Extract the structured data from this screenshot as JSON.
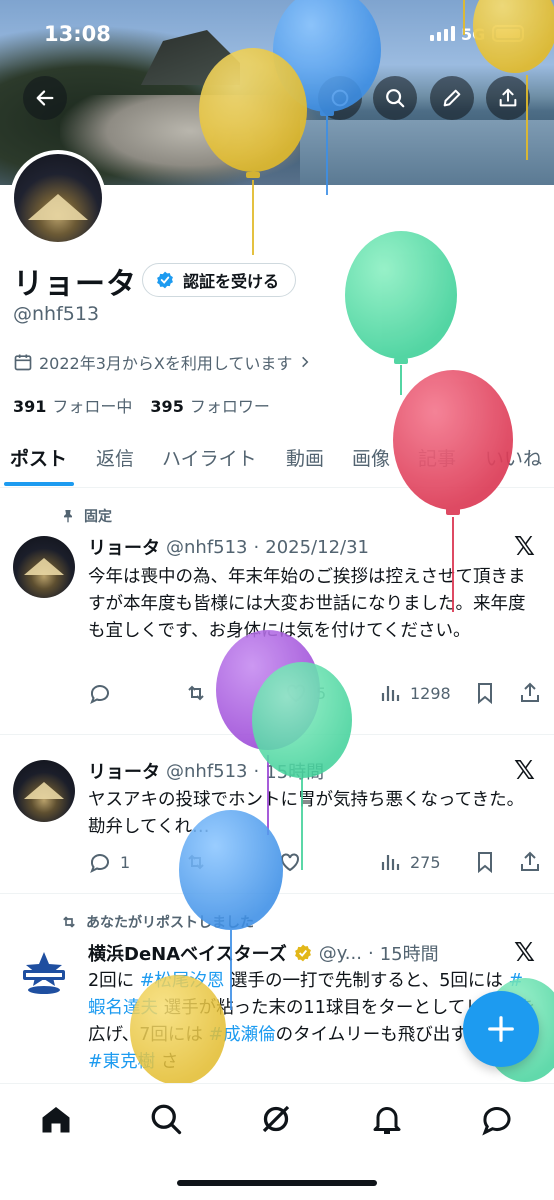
{
  "status_bar": {
    "time": "13:08",
    "network": "5G"
  },
  "header_buttons": [
    "back-arrow-icon",
    "grok-icon",
    "search-icon",
    "edit-icon",
    "share-icon"
  ],
  "profile": {
    "name": "リョータ",
    "verify_label": "認証を受ける",
    "handle": "@nhf513",
    "joined": "2022年3月からXを利用しています",
    "following_count": "391",
    "following_label": "フォロー中",
    "followers_count": "395",
    "followers_label": "フォロワー"
  },
  "tabs": [
    "ポスト",
    "返信",
    "ハイライト",
    "動画",
    "画像",
    "記事",
    "いいね"
  ],
  "active_tab": "ポスト",
  "posts": [
    {
      "context": "固定",
      "name": "リョータ",
      "handle": "@nhf513",
      "time": "2025/12/31",
      "text": "今年は喪中の為、年末年始のご挨拶は控えさせて頂きますが本年度も皆様には大変お世話になりました。来年度も宜しくです、お身体には気を付けてください。",
      "replies": "",
      "reposts": "",
      "likes": "5",
      "views": "1298"
    },
    {
      "name": "リョータ",
      "handle": "@nhf513",
      "time": "15時間",
      "text": "ヤスアキの投球でホントに胃が気持ち悪くなってきた。勘弁してくれ…",
      "replies": "1",
      "reposts": "",
      "likes": "",
      "views": "275"
    },
    {
      "context": "あなたがリポストしました",
      "name": "横浜DeNAベイスターズ",
      "handle": "@y...",
      "time": "15時間",
      "text_parts": [
        {
          "t": "2回に "
        },
        {
          "t": "#松尾汐恩",
          "tag": true
        },
        {
          "t": " 選手の一打で先制すると、5回には "
        },
        {
          "t": "#蝦名達夫",
          "tag": true
        },
        {
          "t": " 選手が粘った末の11球目をタ"
        },
        {
          "t": "ーとしてリードを広げ、7回には "
        },
        {
          "t": "#成瀬倫",
          "tag": true
        },
        {
          "t": "のタイムリーも飛び出す！先発 "
        },
        {
          "t": "#東克樹",
          "tag": true
        },
        {
          "t": " さ"
        }
      ]
    }
  ],
  "colors": {
    "accent": "#1d9bf0",
    "text": "#0f1419",
    "muted": "#536471"
  },
  "bottom_nav": [
    "home-icon",
    "search-icon",
    "grok-icon",
    "notifications-icon",
    "messages-icon"
  ],
  "fab_icon": "plus-icon"
}
